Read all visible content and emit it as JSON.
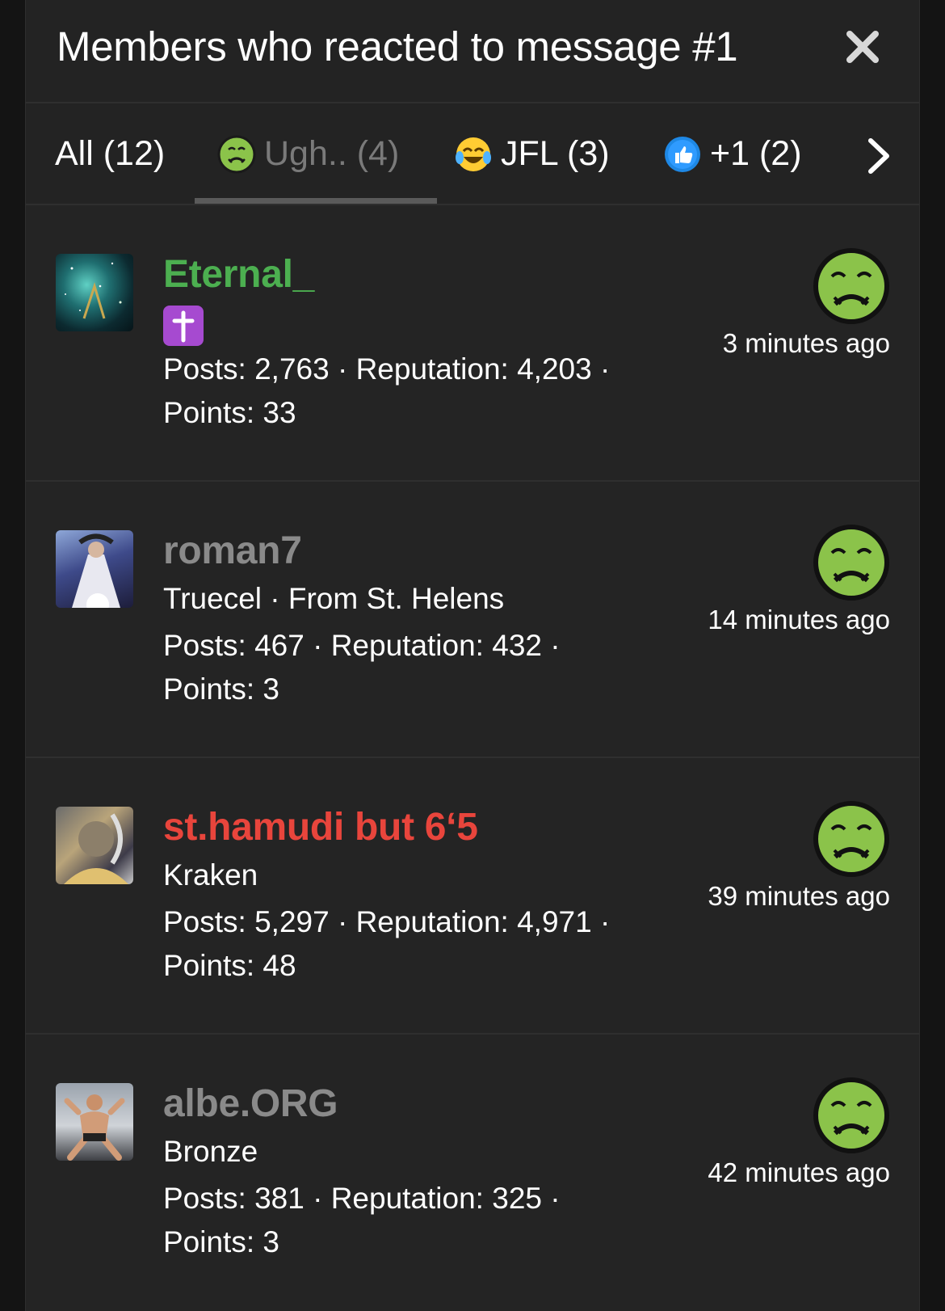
{
  "modal": {
    "title": "Members who reacted to message #1"
  },
  "tabs": [
    {
      "label": "All (12)",
      "icon": null
    },
    {
      "label": "Ugh.. (4)",
      "icon": "nauseated-face-icon",
      "active": true
    },
    {
      "label": "JFL (3)",
      "icon": "laughing-crying-icon"
    },
    {
      "label": "+1 (2)",
      "icon": "thumbs-up-icon"
    }
  ],
  "members": [
    {
      "name": "Eternal_",
      "name_color": "#4caf50",
      "subtitle": "",
      "badge_icon": "latin-cross-icon",
      "stats_line1": "Posts: 2,763 · Reputation: 4,203 ·",
      "stats_line2": "Points: 33",
      "time": "3 minutes ago",
      "reaction": "nauseated-face-icon"
    },
    {
      "name": "roman7",
      "name_color": "#8a8a8a",
      "subtitle": "Truecel · From St. Helens",
      "stats_line1": "Posts: 467 · Reputation: 432 ·",
      "stats_line2": "Points: 3",
      "time": "14 minutes ago",
      "reaction": "nauseated-face-icon"
    },
    {
      "name": "st.hamudi but 6‘5",
      "name_color": "#e8453c",
      "subtitle": "Kraken",
      "stats_line1": "Posts: 5,297 · Reputation: 4,971 ·",
      "stats_line2": "Points: 48",
      "time": "39 minutes ago",
      "reaction": "nauseated-face-icon"
    },
    {
      "name": "albe.ORG",
      "name_color": "#8a8a8a",
      "subtitle": "Bronze",
      "stats_line1": "Posts: 381 · Reputation: 325 ·",
      "stats_line2": "Points: 3",
      "time": "42 minutes ago",
      "reaction": "nauseated-face-icon"
    }
  ]
}
